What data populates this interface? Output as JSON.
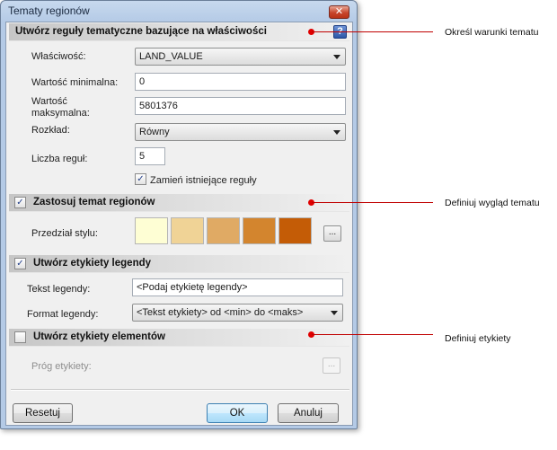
{
  "window": {
    "title": "Tematy regionów",
    "close_glyph": "✕"
  },
  "section_rules": {
    "title": "Utwórz reguły tematyczne bazujące na właściwości",
    "help_glyph": "?",
    "property_label": "Właściwość:",
    "property_value": "LAND_VALUE",
    "min_label": "Wartość minimalna:",
    "min_value": "0",
    "max_label_line1": "Wartość",
    "max_label_line2": "maksymalna:",
    "max_value": "5801376",
    "distribution_label": "Rozkład:",
    "distribution_value": "Równy",
    "rule_count_label": "Liczba reguł:",
    "rule_count_value": "5",
    "replace_rules_checked": true,
    "replace_rules_label": "Zamień istniejące reguły"
  },
  "section_theme": {
    "title": "Zastosuj temat regionów",
    "checked": true,
    "style_range_label": "Przedział stylu:",
    "swatches": [
      "#fefed4",
      "#f0d396",
      "#e0aa64",
      "#d3852e",
      "#c45c06"
    ],
    "more_glyph": "..."
  },
  "section_legend": {
    "title": "Utwórz etykiety legendy",
    "checked": true,
    "text_label": "Tekst legendy:",
    "text_value": "<Podaj etykietę legendy>",
    "format_label": "Format legendy:",
    "format_value": "<Tekst etykiety> od <min> do <maks>"
  },
  "section_labels": {
    "title": "Utwórz etykiety elementów",
    "checked": false,
    "threshold_label": "Próg etykiety:",
    "more_glyph": "..."
  },
  "buttons": {
    "reset": "Resetuj",
    "ok": "OK",
    "cancel": "Anuluj"
  },
  "callouts": {
    "conditions": "Określ warunki tematu",
    "appearance": "Definiuj wygląd tematu",
    "labels": "Definiuj etykiety"
  },
  "colors": {
    "callout": "#c00000",
    "title_bar": "#b4cae6"
  },
  "icons": [
    "close-icon",
    "help-icon",
    "checkbox-check-icon",
    "dropdown-arrow-icon"
  ]
}
